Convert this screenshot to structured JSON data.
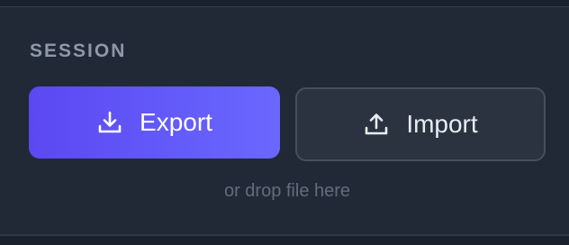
{
  "session": {
    "section_label": "SESSION",
    "export_button": {
      "label": "Export",
      "icon": "download-icon"
    },
    "import_button": {
      "label": "Import",
      "icon": "upload-icon"
    },
    "drop_hint": "or drop file here"
  },
  "colors": {
    "accent_start": "#5b48f2",
    "accent_end": "#6a68ff",
    "panel_bg": "#212937",
    "muted_text": "#8e98a8"
  }
}
